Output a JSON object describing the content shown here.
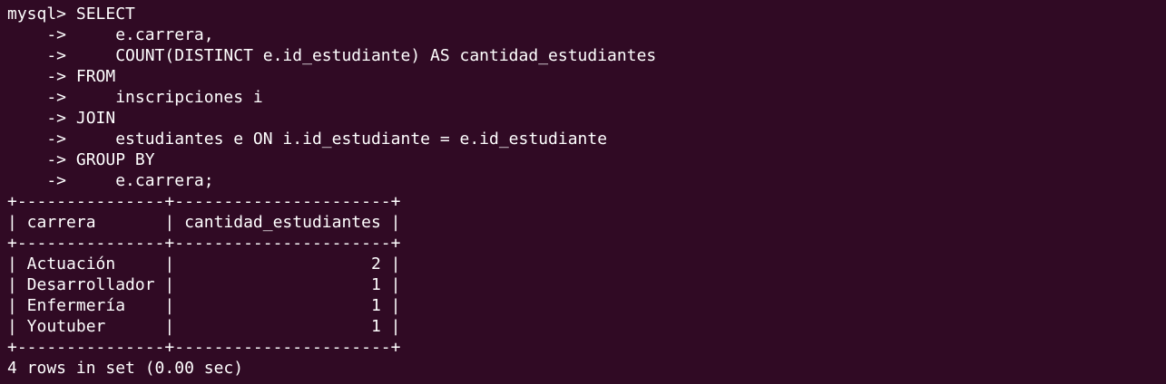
{
  "terminal": {
    "prompt": "mysql> ",
    "query_lines": [
      "SELECT",
      "    ->     e.carrera,",
      "    ->     COUNT(DISTINCT e.id_estudiante) AS cantidad_estudiantes",
      "    -> FROM",
      "    ->     inscripciones i",
      "    -> JOIN",
      "    ->     estudiantes e ON i.id_estudiante = e.id_estudiante",
      "    -> GROUP BY",
      "    ->     e.carrera;"
    ],
    "table": {
      "border": "+---------------+----------------------+",
      "header_row": "| carrera       | cantidad_estudiantes |",
      "rows": [
        "| Actuación     |                    2 |",
        "| Desarrollador |                    1 |",
        "| Enfermería    |                    1 |",
        "| Youtuber      |                    1 |"
      ]
    },
    "footer": "4 rows in set (0.00 sec)"
  },
  "colors": {
    "background": "#300a24",
    "text": "#ffffff"
  }
}
